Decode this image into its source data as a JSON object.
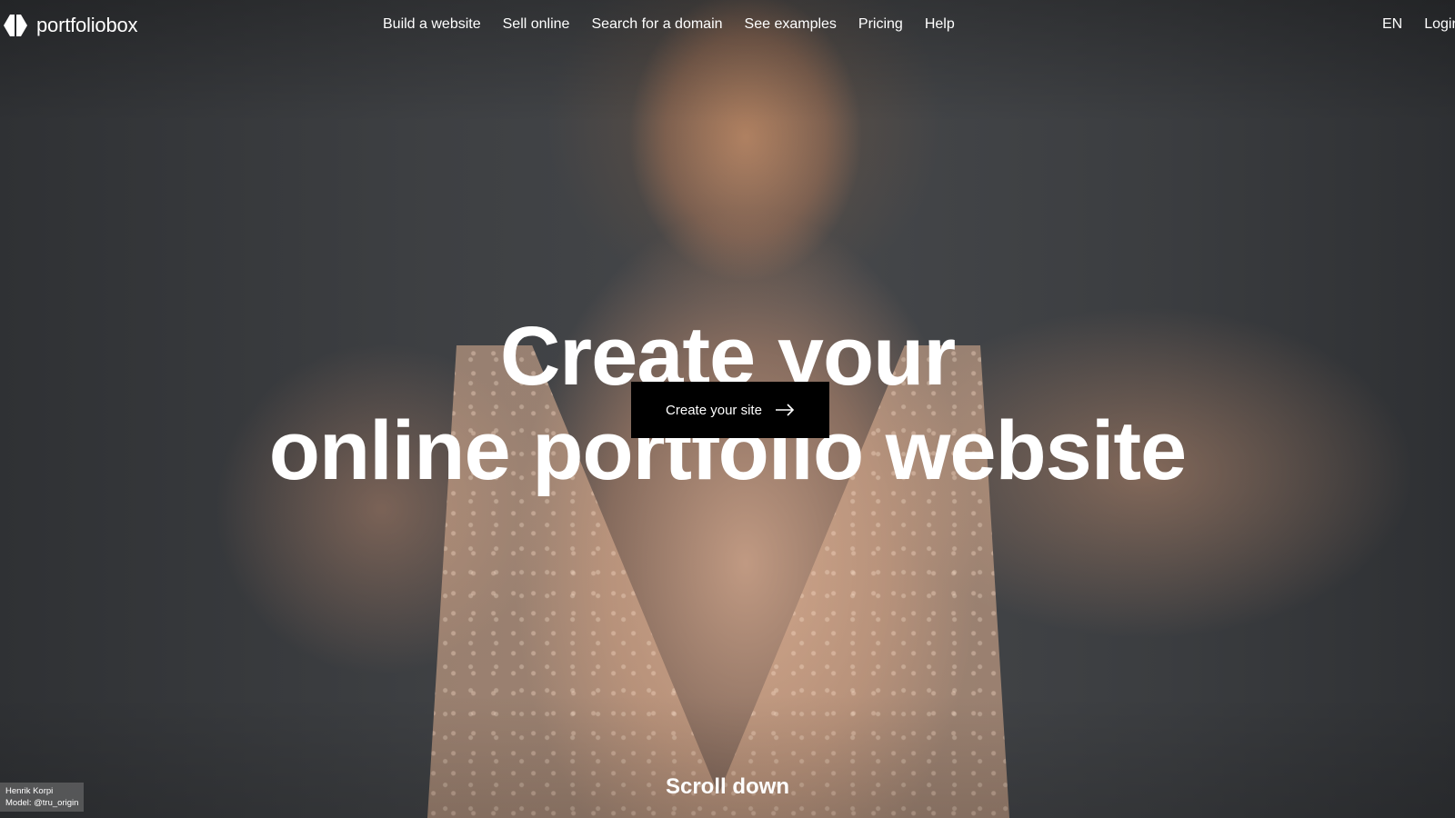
{
  "header": {
    "logo_text": "portfoliobox",
    "nav": [
      {
        "label": "Build a website"
      },
      {
        "label": "Sell online"
      },
      {
        "label": "Search for a domain"
      },
      {
        "label": "See examples"
      },
      {
        "label": "Pricing"
      },
      {
        "label": "Help"
      }
    ],
    "language": "EN",
    "login": "Login"
  },
  "hero": {
    "title_line1": "Create your",
    "title_line2": "online portfolio website",
    "cta_label": "Create your site",
    "scroll_label": "Scroll down"
  },
  "credit": {
    "photographer": "Henrik Korpi",
    "model": "Model: @tru_origin"
  },
  "icons": {
    "logo": "portfoliobox-logo-icon",
    "cta_arrow": "arrow-right-icon"
  },
  "colors": {
    "cta_background": "#000000",
    "text": "#ffffff"
  }
}
